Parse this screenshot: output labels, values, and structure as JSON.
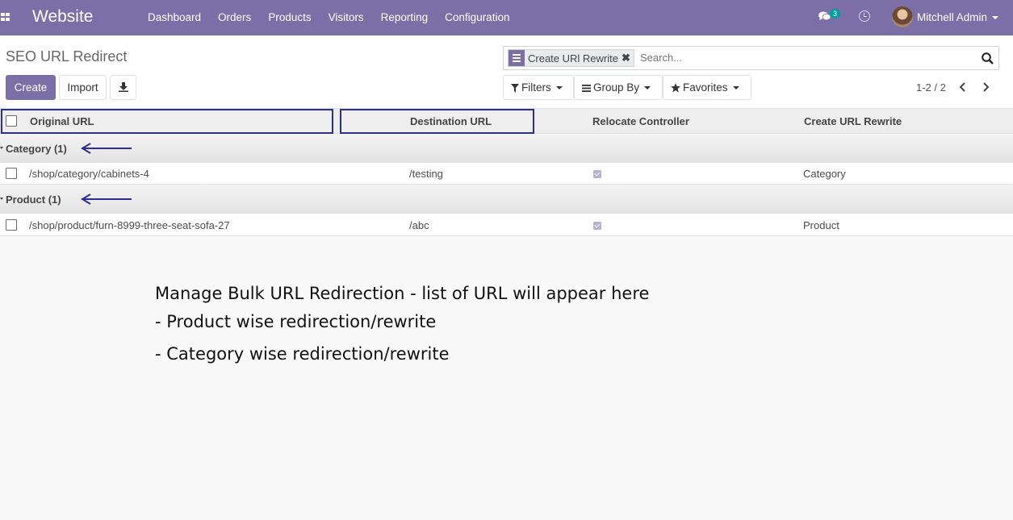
{
  "navbar": {
    "brand": "Website",
    "menu": [
      "Dashboard",
      "Orders",
      "Products",
      "Visitors",
      "Reporting",
      "Configuration"
    ],
    "chat_count": "3",
    "user_name": "Mitchell Admin",
    "bg_color": "#7c6fa8"
  },
  "control": {
    "title": "SEO URL Redirect",
    "create_label": "Create",
    "import_label": "Import",
    "search": {
      "facet_label": "Create URl Rewrite",
      "placeholder": "Search..."
    },
    "filters_label": "Filters",
    "group_by_label": "Group By",
    "favorites_label": "Favorites",
    "pager": "1-2 / 2"
  },
  "table": {
    "columns": [
      "Original URL",
      "Destination URL",
      "Relocate Controller",
      "Create URL Rewrite"
    ],
    "groups": [
      {
        "label": "Category (1)",
        "rows": [
          {
            "original_url": "/shop/category/cabinets-4",
            "destination_url": "/testing",
            "relocate_controller": true,
            "create_url_rewrite": "Category"
          }
        ]
      },
      {
        "label": "Product (1)",
        "rows": [
          {
            "original_url": "/shop/product/furn-8999-three-seat-sofa-27",
            "destination_url": "/abc",
            "relocate_controller": true,
            "create_url_rewrite": "Product"
          }
        ]
      }
    ]
  },
  "annotation": {
    "heading": "Manage Bulk URL Redirection - list of URL will appear here",
    "lines": [
      "- Product wise redirection/rewrite",
      "- Category wise redirection/rewrite"
    ],
    "highlight_color": "#2b2f91"
  }
}
